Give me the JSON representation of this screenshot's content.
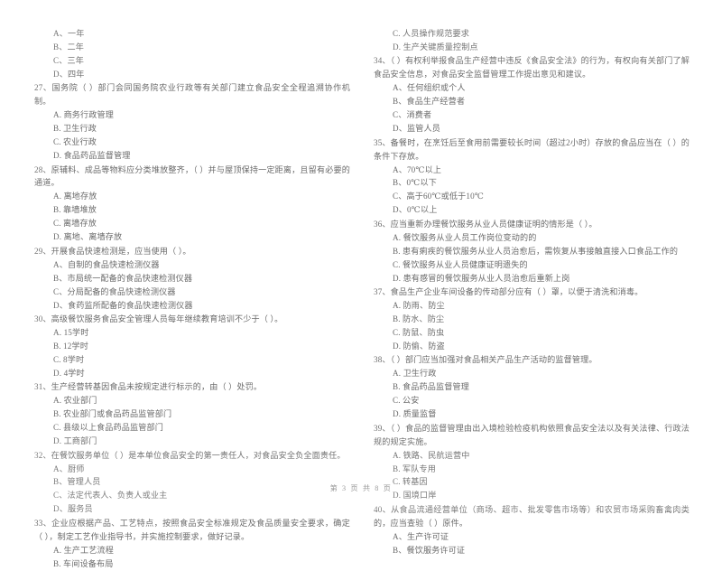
{
  "document": {
    "footer_page_label": "第 3 页 共 8 页"
  },
  "left_column": {
    "questions": [
      {
        "stem": "",
        "options": [
          "A、一年",
          "B、二年",
          "C、三年",
          "D、四年"
        ]
      },
      {
        "stem": "27、国务院（      ）部门会同国务院农业行政等有关部门建立食品安全全程追溯协作机制。",
        "options": [
          "A. 商务行政管理",
          "B. 卫生行政",
          "C. 农业行政",
          "D. 食品药品监督管理"
        ]
      },
      {
        "stem": "28、原辅料、成品等物料应分类堆放整齐，（       ）并与屋顶保持一定距离，且留有必要的通道。",
        "options": [
          "A. 离地存放",
          "B. 靠墙堆放",
          "C. 离墙存放",
          "D. 离地、离墙存放"
        ]
      },
      {
        "stem": "29、开展食品快速检测是，应当使用（      ）。",
        "options": [
          "A、自制的食品快速检测仪器",
          "B、市局统一配备的食品快速检测仪器",
          "C、分局配备的食品快速检测仪器",
          "D、食药监所配备的食品快速检测仪器"
        ]
      },
      {
        "stem": "30、高级餐饮服务食品安全管理人员每年继续教育培训不少于（      ）。",
        "options": [
          "A. 15学时",
          "B. 12学时",
          "C. 8学时",
          "D. 4学时"
        ]
      },
      {
        "stem": "31、生产经营转基因食品未按规定进行标示的，由（     ）处罚。",
        "options": [
          "A. 农业部门",
          "B. 农业部门或食品药品监管部门",
          "C. 县级以上食品药品监管部门",
          "D. 工商部门"
        ]
      },
      {
        "stem": "32、在餐饮服务单位（      ）是本单位食品安全的第一责任人，对食品安全负全面责任。",
        "options": [
          "A、厨师",
          "B、管理人员",
          "C、法定代表人、负责人或业主",
          "D、服务员"
        ]
      },
      {
        "stem": "33、企业应根据产品、工艺特点，按照食品安全标准规定及食品质量安全要求，确定（      ），制定工艺作业指导书，并实施控制要求，做好记录。",
        "options": [
          "A. 生产工艺流程",
          "B. 车间设备布局"
        ]
      }
    ]
  },
  "right_column": {
    "questions": [
      {
        "stem": "",
        "options": [
          "C. 人员操作规范要求",
          "D. 生产关键质量控制点"
        ]
      },
      {
        "stem": "34、（       ）有权利举报食品生产经营中违反《食品安全法》的行为，有权向有关部门了解食品安全信息，对食品安全监督管理工作提出意见和建议。",
        "options": [
          "A、任何组织或个人",
          "B、食品生产经营者",
          "C、消费者",
          "D、监管人员"
        ]
      },
      {
        "stem": "35、备餐时，在烹饪后至食用前需要较长时间（超过2小时）存放的食品应当在（       ）的条件下存放。",
        "options": [
          "A、70℃以上",
          "B、0℃以下",
          "C、高于60℃或低于10℃",
          "D、0℃以上"
        ]
      },
      {
        "stem": "36、应当重新办理餐饮服务从业人员健康证明的情形是（     ）。",
        "options": [
          "A. 餐饮服务从业人员工作岗位变动的的",
          "B. 患有痢疾的餐饮服务从业人员治愈后，需恢复从事接触直接入口食品工作的",
          "C. 餐饮服务从业人员健康证明遗失的",
          "D. 患有感冒的餐饮服务从业人员治愈后重新上岗"
        ]
      },
      {
        "stem": "37、食品生产企业车间设备的传动部分应有（      ）罩，以便于清洗和消毒。",
        "options": [
          "A. 防雨、防尘",
          "B. 防水、防尘",
          "C. 防鼠、防虫",
          "D. 防偷、防盗"
        ]
      },
      {
        "stem": "38、（      ）部门应当加强对食品相关产品生产活动的监督管理。",
        "options": [
          "A. 卫生行政",
          "B. 食品药品监督管理",
          "C. 公安",
          "D. 质量监督"
        ]
      },
      {
        "stem": "39、（       ）食品的监督管理由出入境检验检疫机构依照食品安全法以及有关法律、行政法规的规定实施。",
        "options": [
          "A. 铁路、民航运营中",
          "B. 军队专用",
          "C. 转基因",
          "D. 国境口岸"
        ]
      },
      {
        "stem": "40、从食品流通经营单位（商场、超市、批发零售市场等）和农贸市场采购畜禽肉类的，应当查验（      ）原件。",
        "options": [
          "A、生产许可证",
          "B、餐饮服务许可证"
        ]
      }
    ]
  }
}
